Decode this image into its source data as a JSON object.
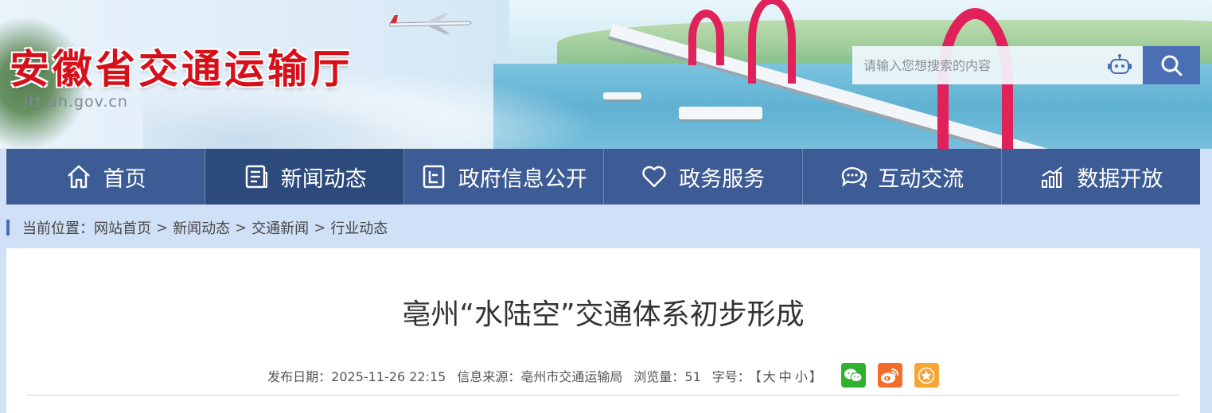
{
  "header": {
    "site_title": "安徽省交通运输厅",
    "site_domain": "jtt.ah.gov.cn",
    "search_placeholder": "请输入您想搜索的内容"
  },
  "nav": {
    "items": [
      {
        "label": "首页",
        "icon": "home-icon"
      },
      {
        "label": "新闻动态",
        "icon": "news-document-icon",
        "active": true
      },
      {
        "label": "政府信息公开",
        "icon": "info-disclosure-icon"
      },
      {
        "label": "政务服务",
        "icon": "heart-icon"
      },
      {
        "label": "互动交流",
        "icon": "chat-bubbles-icon"
      },
      {
        "label": "数据开放",
        "icon": "bar-chart-icon"
      }
    ]
  },
  "breadcrumb": {
    "prefix": "当前位置：",
    "items": [
      "网站首页",
      "新闻动态",
      "交通新闻",
      "行业动态"
    ],
    "separator": ">"
  },
  "article": {
    "title": "亳州“水陆空”交通体系初步形成",
    "publish_date_label": "发布日期：",
    "publish_date": "2025-11-26 22:15",
    "source_label": "信息来源：",
    "source": "亳州市交通运输局",
    "views_label": "浏览量：",
    "views": "51",
    "font_label": "字号：",
    "font_open": "【",
    "font_large": "大",
    "font_medium": "中",
    "font_small": "小",
    "font_close": "】"
  },
  "share": [
    "wechat-icon",
    "weibo-icon",
    "favorite-star-icon"
  ],
  "colors": {
    "nav_bg": "#3d5c95",
    "nav_active": "#2d4a7c",
    "title_red": "#d6101a",
    "page_bg": "#cfe0f7",
    "search_button": "#4a6fb5"
  }
}
